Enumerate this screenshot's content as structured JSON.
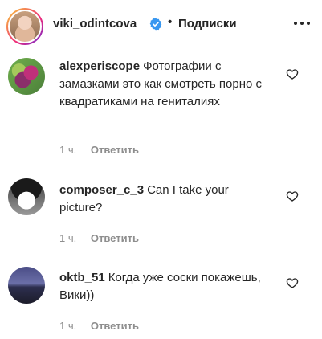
{
  "header": {
    "username": "viki_odintcova",
    "separator": "•",
    "follow_status": "Подписки",
    "more_icon": "more-options-icon",
    "verified_icon": "verified-badge-icon"
  },
  "comments": [
    {
      "username": "alexperiscope",
      "text": "Фотографии с замазками это как смотреть порно с квадратиками на гениталиях",
      "time": "1 ч.",
      "reply_label": "Ответить"
    },
    {
      "username": "composer_c_3",
      "text": "Can I take your picture?",
      "time": "1 ч.",
      "reply_label": "Ответить"
    },
    {
      "username": "oktb_51",
      "text": "Когда уже соски покажешь, Вики))",
      "time": "1 ч.",
      "reply_label": "Ответить"
    }
  ],
  "colors": {
    "text": "#262626",
    "meta": "#8e8e8e",
    "verified": "#3897f0"
  }
}
